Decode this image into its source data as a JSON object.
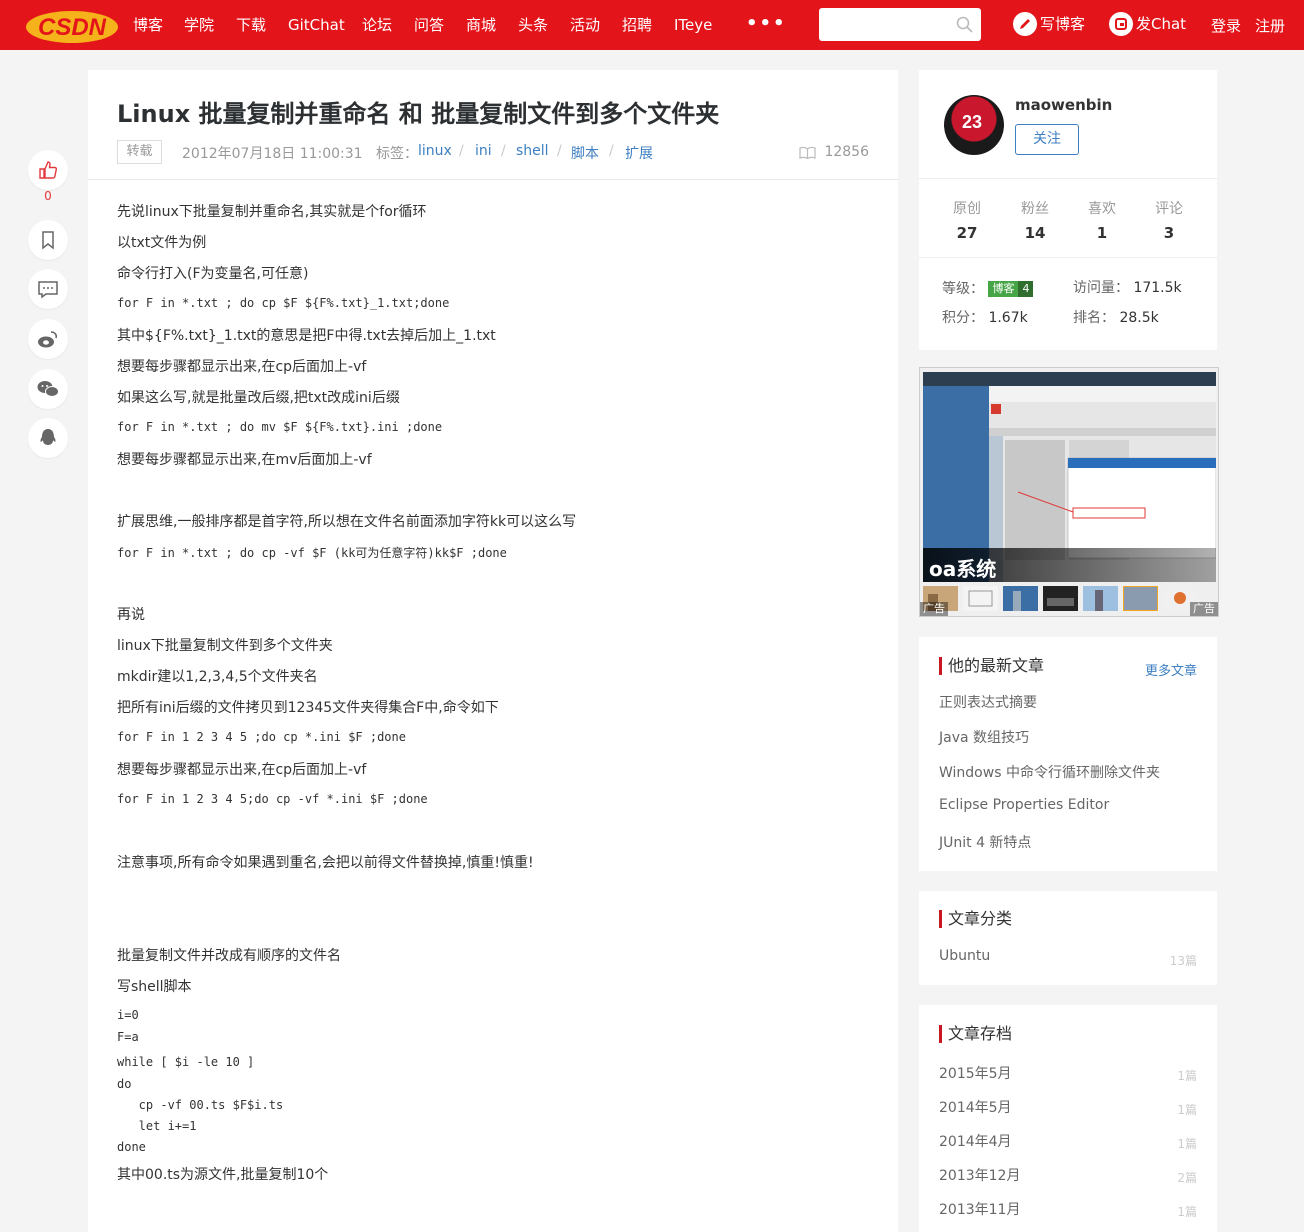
{
  "nav": {
    "logo_text": "CSDN",
    "items": [
      "博客",
      "学院",
      "下载",
      "GitChat",
      "论坛",
      "问答",
      "商城",
      "头条",
      "活动",
      "招聘",
      "ITeye"
    ],
    "more": "•••",
    "search_placeholder": "",
    "write_blog": "写博客",
    "chat": "发Chat",
    "login": "登录",
    "register": "注册"
  },
  "tools": {
    "like_count": "0"
  },
  "article": {
    "title": "Linux 批量复制并重命名 和 批量复制文件到多个文件夹",
    "repost_badge": "转载",
    "date": "2012年07月18日 11:00:31",
    "tags_label": "标签：",
    "tags": [
      "linux",
      "ini",
      "shell",
      "脚本",
      "扩展"
    ],
    "views": "12856",
    "lines": [
      {
        "text": "先说linux下批量复制并重命名,其实就是个for循环",
        "kind": "txt"
      },
      {
        "text": "以txt文件为例",
        "kind": "txt"
      },
      {
        "text": "命令行打入(F为变量名,可任意)",
        "kind": "txt"
      },
      {
        "text": "for F in *.txt ; do cp $F ${F%.txt}_1.txt;done",
        "kind": "code"
      },
      {
        "text": "其中${F%.txt}_1.txt的意思是把F中得.txt去掉后加上_1.txt",
        "kind": "txt"
      },
      {
        "text": "想要每步骤都显示出来,在cp后面加上-vf",
        "kind": "txt"
      },
      {
        "text": "如果这么写,就是批量改后缀,把txt改成ini后缀",
        "kind": "txt"
      },
      {
        "text": "for F in *.txt ; do mv $F ${F%.txt}.ini ;done",
        "kind": "code"
      },
      {
        "text": "想要每步骤都显示出来,在mv后面加上-vf",
        "kind": "txt"
      },
      {
        "text": "扩展思维,一般排序都是首字符,所以想在文件名前面添加字符kk可以这么写",
        "kind": "txt"
      },
      {
        "text": "for F in *.txt ; do cp -vf $F (kk可为任意字符)kk$F ;done",
        "kind": "code"
      },
      {
        "text": "再说",
        "kind": "txt"
      },
      {
        "text": "linux下批量复制文件到多个文件夹",
        "kind": "txt"
      },
      {
        "text": "mkdir建以1,2,3,4,5个文件夹名",
        "kind": "txt"
      },
      {
        "text": "把所有ini后缀的文件拷贝到12345文件夹得集合F中,命令如下",
        "kind": "txt"
      },
      {
        "text": "for F in 1 2 3 4 5 ;do cp *.ini $F ;done",
        "kind": "code"
      },
      {
        "text": "想要每步骤都显示出来,在cp后面加上-vf",
        "kind": "txt"
      },
      {
        "text": "for F in 1 2 3 4 5;do cp -vf *.ini $F ;done",
        "kind": "code"
      },
      {
        "text": "注意事项,所有命令如果遇到重名,会把以前得文件替换掉,慎重!慎重!",
        "kind": "txt"
      },
      {
        "text": "批量复制文件并改成有顺序的文件名",
        "kind": "txt"
      },
      {
        "text": "写shell脚本",
        "kind": "txt"
      },
      {
        "text": "i=0",
        "kind": "code"
      },
      {
        "text": "F=a",
        "kind": "code"
      },
      {
        "text": "while [ $i -le 10 ]",
        "kind": "code"
      },
      {
        "text": "do",
        "kind": "code"
      },
      {
        "text": "   cp -vf 00.ts $F$i.ts",
        "kind": "code"
      },
      {
        "text": "   let i+=1",
        "kind": "code"
      },
      {
        "text": "done",
        "kind": "code"
      },
      {
        "text": "其中00.ts为源文件,批量复制10个",
        "kind": "txt"
      }
    ]
  },
  "profile": {
    "avatar_number": "23",
    "username": "maowenbin",
    "follow": "关注",
    "stats": [
      {
        "label": "原创",
        "value": "27"
      },
      {
        "label": "粉丝",
        "value": "14"
      },
      {
        "label": "喜欢",
        "value": "1"
      },
      {
        "label": "评论",
        "value": "3"
      }
    ],
    "level_label": "等级：",
    "level_badge": "博客",
    "level_num": "4",
    "visits_label": "访问量：",
    "visits": "171.5k",
    "points_label": "积分：",
    "points": "1.67k",
    "rank_label": "排名：",
    "rank": "28.5k"
  },
  "ad": {
    "caption": "oa系统",
    "tag": "广告"
  },
  "latest": {
    "title": "他的最新文章",
    "more": "更多文章",
    "items": [
      "正则表达式摘要",
      "Java 数组技巧",
      "Windows 中命令行循环删除文件夹",
      "Eclipse Properties Editor",
      "JUnit 4 新特点"
    ]
  },
  "categories": {
    "title": "文章分类",
    "items": [
      {
        "name": "Ubuntu",
        "count": "13篇"
      }
    ]
  },
  "archive": {
    "title": "文章存档",
    "items": [
      {
        "name": "2015年5月",
        "count": "1篇"
      },
      {
        "name": "2014年5月",
        "count": "1篇"
      },
      {
        "name": "2014年4月",
        "count": "1篇"
      },
      {
        "name": "2013年12月",
        "count": "2篇"
      },
      {
        "name": "2013年11月",
        "count": "1篇"
      }
    ]
  },
  "colors": {
    "brand_red": "#e4141b",
    "link_blue": "#3d7fc2",
    "level_green": "#46a546"
  }
}
